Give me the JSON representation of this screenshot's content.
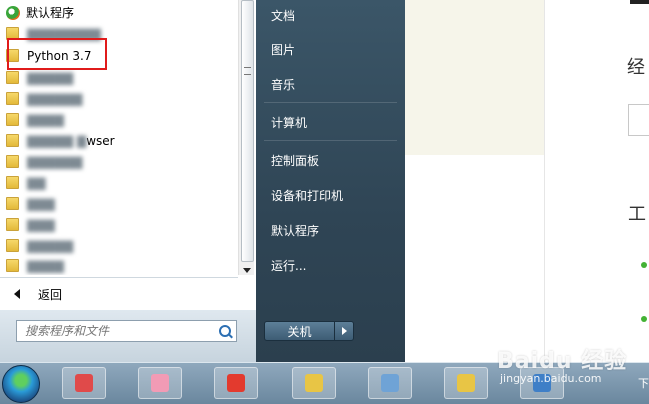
{
  "start_menu": {
    "programs": {
      "default_programs": "默认程序",
      "python": "Python 3.7",
      "partial_item": "wser",
      "back": "返回"
    },
    "search": {
      "placeholder": "搜索程序和文件"
    },
    "places": [
      "文档",
      "图片",
      "音乐",
      "计算机",
      "控制面板",
      "设备和打印机",
      "默认程序",
      "运行..."
    ],
    "shutdown": "关机"
  },
  "background_page": {
    "heading_1": "经",
    "heading_2": "工"
  },
  "watermark": {
    "brand": "Baidu 经验",
    "url": "jingyan.baidu.com"
  },
  "taskbar": {
    "clock_partial": "下"
  },
  "colors": {
    "highlight_border": "#e01b1b",
    "places_panel": "#2f4555",
    "dot_green": "#43b234"
  }
}
